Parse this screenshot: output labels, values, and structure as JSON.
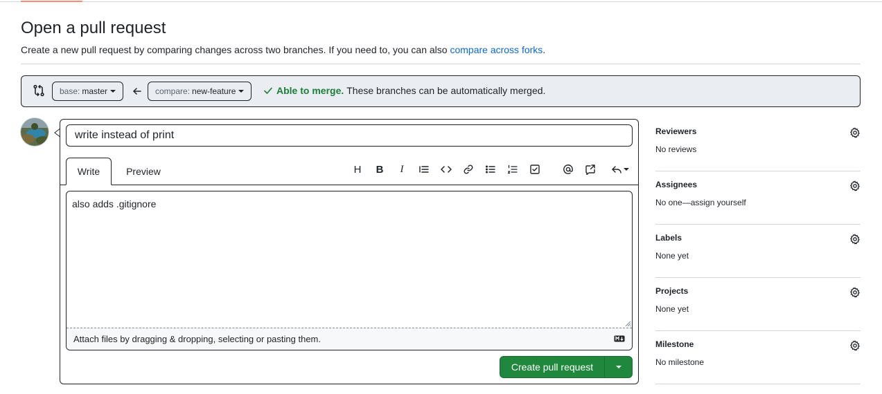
{
  "page": {
    "title": "Open a pull request",
    "subtitle_text": "Create a new pull request by comparing changes across two branches. If you need to, you can also ",
    "subtitle_link": "compare across forks",
    "subtitle_end": "."
  },
  "range": {
    "base_prefix": "base:",
    "base_branch": "master",
    "compare_prefix": "compare:",
    "compare_branch": "new-feature",
    "merge_ok": "Able to merge.",
    "merge_text": "These branches can be automatically merged."
  },
  "composer": {
    "title_value": "write instead of print",
    "tabs": {
      "write": "Write",
      "preview": "Preview"
    },
    "toolbar": {
      "heading": "H",
      "bold": "B",
      "italic": "I"
    },
    "body_value": "also adds .gitignore",
    "attach_text": "Attach files by dragging & dropping, selecting or pasting them.",
    "submit_label": "Create pull request"
  },
  "sidebar": {
    "sections": [
      {
        "heading": "Reviewers",
        "value": "No reviews"
      },
      {
        "heading": "Assignees",
        "value": "No one—assign yourself"
      },
      {
        "heading": "Labels",
        "value": "None yet"
      },
      {
        "heading": "Projects",
        "value": "None yet"
      },
      {
        "heading": "Milestone",
        "value": "No milestone"
      }
    ]
  },
  "colors": {
    "accent_link": "#0969da",
    "success": "#1a7f37",
    "primary_button": "#1f883d",
    "tab_indicator": "#fd8c73"
  },
  "icons": [
    "git-compare-icon",
    "arrow-left-icon",
    "check-icon",
    "gear-icon",
    "markdown-icon"
  ]
}
